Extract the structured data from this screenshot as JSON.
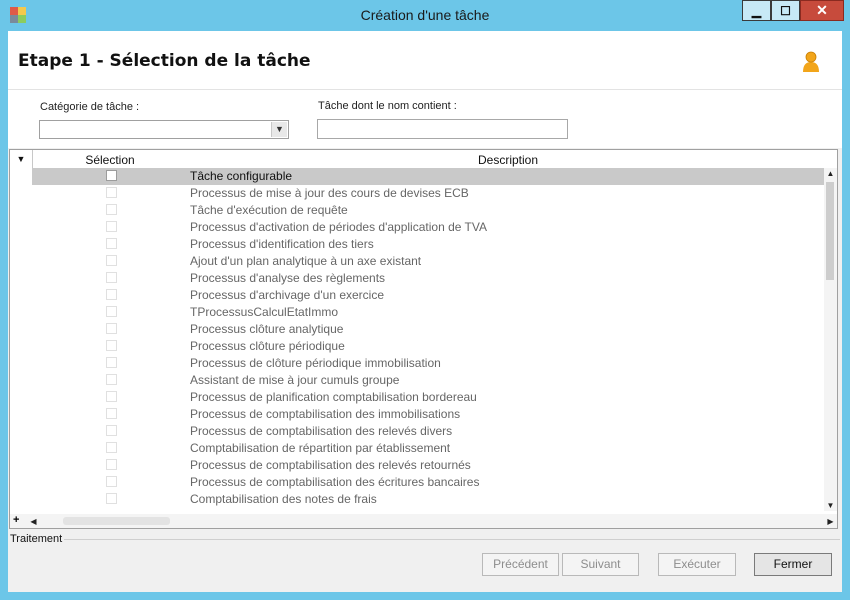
{
  "window": {
    "title": "Création d'une tâche",
    "minimize_label": "▁",
    "maximize_label": "☐",
    "close_label": "✕"
  },
  "header": {
    "title": "Etape 1 - Sélection de la tâche"
  },
  "filters": {
    "category_label": "Catégorie de tâche :",
    "category_value": "",
    "name_label": "Tâche dont le nom contient :",
    "name_value": ""
  },
  "grid": {
    "columns": [
      "Sélection",
      "Description"
    ],
    "rows": [
      {
        "label": "Tâche configurable",
        "checked": false,
        "selected": true
      },
      {
        "label": "Processus de mise à jour des cours de devises ECB",
        "checked": false,
        "selected": false
      },
      {
        "label": "Tâche d'exécution de requête",
        "checked": false,
        "selected": false
      },
      {
        "label": "Processus d'activation de périodes d'application de TVA",
        "checked": false,
        "selected": false
      },
      {
        "label": "Processus d'identification des tiers",
        "checked": false,
        "selected": false
      },
      {
        "label": "Ajout d'un plan analytique à un axe existant",
        "checked": false,
        "selected": false
      },
      {
        "label": "Processus d'analyse des règlements",
        "checked": false,
        "selected": false
      },
      {
        "label": "Processus d'archivage d'un exercice",
        "checked": false,
        "selected": false
      },
      {
        "label": "TProcessusCalculEtatImmo",
        "checked": false,
        "selected": false
      },
      {
        "label": "Processus clôture analytique",
        "checked": false,
        "selected": false
      },
      {
        "label": "Processus clôture périodique",
        "checked": false,
        "selected": false
      },
      {
        "label": "Processus de clôture périodique immobilisation",
        "checked": false,
        "selected": false
      },
      {
        "label": "Assistant de mise à jour cumuls groupe",
        "checked": false,
        "selected": false
      },
      {
        "label": "Processus de planification comptabilisation bordereau",
        "checked": false,
        "selected": false
      },
      {
        "label": "Processus de comptabilisation des immobilisations",
        "checked": false,
        "selected": false
      },
      {
        "label": "Processus de comptabilisation des relevés divers",
        "checked": false,
        "selected": false
      },
      {
        "label": "Comptabilisation de répartition par établissement",
        "checked": false,
        "selected": false
      },
      {
        "label": "Processus de comptabilisation des relevés retournés",
        "checked": false,
        "selected": false
      },
      {
        "label": "Processus de comptabilisation des écritures bancaires",
        "checked": false,
        "selected": false
      },
      {
        "label": "Comptabilisation des notes de frais",
        "checked": false,
        "selected": false
      }
    ],
    "add_label": "+"
  },
  "footer": {
    "section_label": "Traitement",
    "previous_label": "Précédent",
    "next_label": "Suivant",
    "execute_label": "Exécuter",
    "close_label": "Fermer"
  },
  "colors": {
    "frame": "#6cc6e8",
    "selected_row": "#c9c9c9"
  },
  "icons": [
    "app-icon",
    "user-icon",
    "chevron-down-icon",
    "scroll-up-icon",
    "scroll-down-icon",
    "scroll-left-icon",
    "scroll-right-icon"
  ]
}
